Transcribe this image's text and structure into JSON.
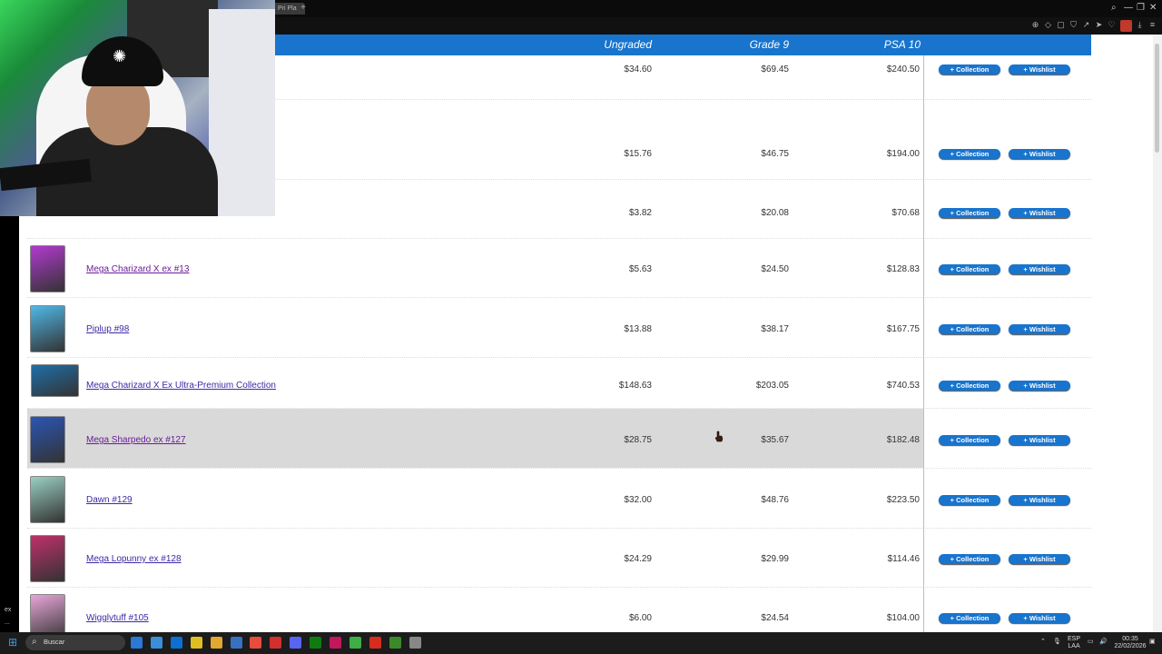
{
  "browser": {
    "tab_label": "Pri Pla",
    "new_tab": "+",
    "win_controls": [
      "—",
      "❐",
      "✕"
    ],
    "toolbar_icons": [
      "zoom-icon",
      "bookmark-icon",
      "screenshot-icon",
      "shield-icon",
      "share-icon",
      "heart-icon",
      "download-icon",
      "menu-icon"
    ]
  },
  "left_band": {
    "label_top": "ex",
    "label_bottom": "..."
  },
  "table": {
    "headers": {
      "ungraded": "Ungraded",
      "grade9": "Grade 9",
      "psa10": "PSA 10"
    },
    "collection_label": "+ Collection",
    "wishlist_label": "+ Wishlist",
    "rows": [
      {
        "name": "",
        "ungraded": "$34.60",
        "grade9": "$69.45",
        "psa10": "$240.50",
        "thumb_color": ""
      },
      {
        "name": "",
        "ungraded": "$15.76",
        "grade9": "$46.75",
        "psa10": "$194.00",
        "thumb_color": ""
      },
      {
        "name": "",
        "ungraded": "$3.82",
        "grade9": "$20.08",
        "psa10": "$70.68",
        "thumb_color": ""
      },
      {
        "name": "Mega Charizard X ex #13",
        "ungraded": "$5.63",
        "grade9": "$24.50",
        "psa10": "$128.83",
        "thumb_color": "#b23ad1"
      },
      {
        "name": "Piplup #98",
        "ungraded": "$13.88",
        "grade9": "$38.17",
        "psa10": "$167.75",
        "thumb_color": "#4fb8e8"
      },
      {
        "name": "Mega Charizard X Ex Ultra-Premium Collection",
        "ungraded": "$148.63",
        "grade9": "$203.05",
        "psa10": "$740.53",
        "thumb_color": "#1f6fa8"
      },
      {
        "name": "Mega Sharpedo ex #127",
        "ungraded": "$28.75",
        "grade9": "$35.67",
        "psa10": "$182.48",
        "thumb_color": "#2a55b5"
      },
      {
        "name": "Dawn #129",
        "ungraded": "$32.00",
        "grade9": "$48.76",
        "psa10": "$223.50",
        "thumb_color": "#9ad0c2"
      },
      {
        "name": "Mega Lopunny ex #128",
        "ungraded": "$24.29",
        "grade9": "$29.99",
        "psa10": "$114.46",
        "thumb_color": "#c0306a"
      },
      {
        "name": "Wigglytuff #105",
        "ungraded": "$6.00",
        "grade9": "$24.54",
        "psa10": "$104.00",
        "thumb_color": "#e8a6d8"
      }
    ]
  },
  "taskbar": {
    "search_placeholder": "Buscar",
    "lang_top": "ESP",
    "lang_bottom": "LAA",
    "time": "00:35",
    "date": "22/02/2026",
    "app_icons": [
      "explorer-icon",
      "store-icon",
      "mail-icon",
      "notes-icon",
      "folder-icon",
      "terminal-icon",
      "chrome-icon",
      "opera-icon",
      "discord-icon",
      "xbox-icon",
      "media-icon",
      "play-icon",
      "streamlabs-icon",
      "minecraft-icon",
      "obs-icon"
    ]
  },
  "colors": {
    "accent": "#1874cd",
    "highlight_row": "#d9d9d9"
  }
}
